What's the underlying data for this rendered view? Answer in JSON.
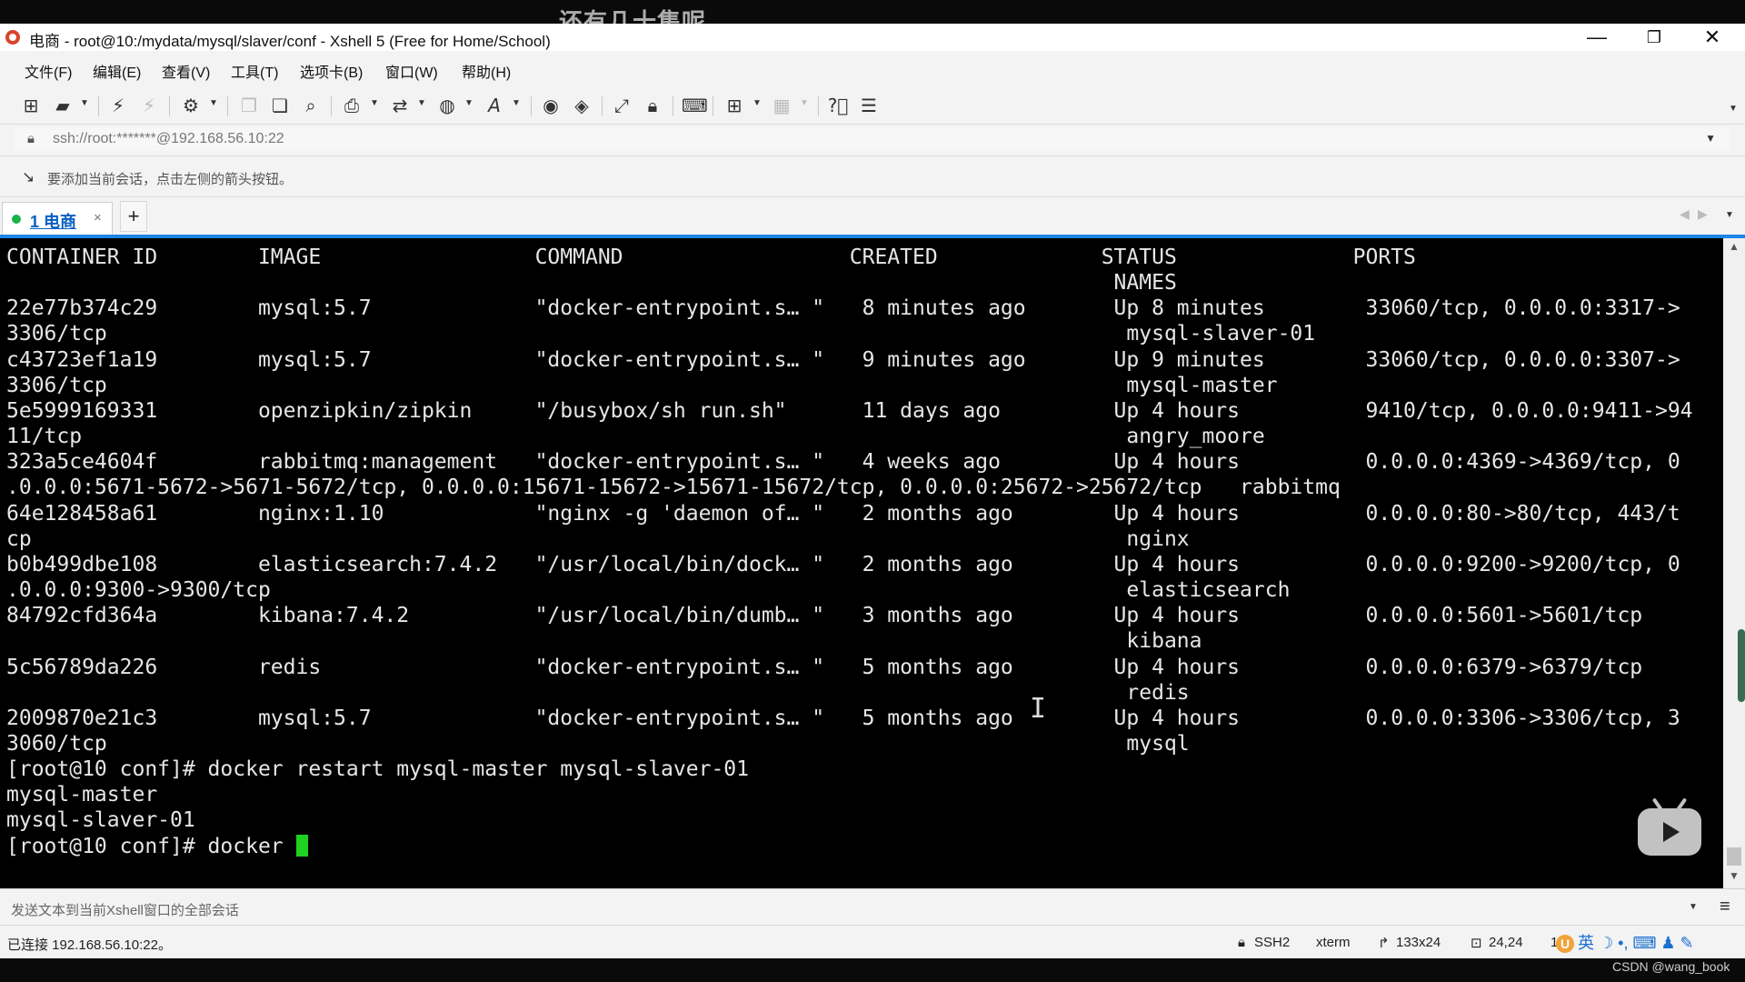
{
  "overlay_caption": "还有几十集呢",
  "window": {
    "title": "电商 - root@10:/mydata/mysql/slaver/conf - Xshell 5 (Free for Home/School)",
    "minimize": "—",
    "restore": "❐",
    "close": "✕"
  },
  "menu": [
    {
      "label": "文件(F)"
    },
    {
      "label": "编辑(E)"
    },
    {
      "label": "查看(V)"
    },
    {
      "label": "工具(T)"
    },
    {
      "label": "选项卡(B)"
    },
    {
      "label": "窗口(W)"
    },
    {
      "label": "帮助(H)"
    }
  ],
  "address": {
    "value": "ssh://root:*******@192.168.56.10:22"
  },
  "hint": {
    "text": "要添加当前会话，点击左侧的箭头按钮。"
  },
  "tabs": {
    "active_label": "1 电商",
    "add_label": "+"
  },
  "terminal": {
    "lines": [
      "CONTAINER ID        IMAGE                 COMMAND                  CREATED             STATUS              PORTS",
      "                                                                                        NAMES",
      "22e77b374c29        mysql:5.7             \"docker-entrypoint.s… \"   8 minutes ago       Up 8 minutes        33060/tcp, 0.0.0.0:3317->",
      "3306/tcp                                                                                 mysql-slaver-01",
      "c43723ef1a19        mysql:5.7             \"docker-entrypoint.s… \"   9 minutes ago       Up 9 minutes        33060/tcp, 0.0.0.0:3307->",
      "3306/tcp                                                                                 mysql-master",
      "5e5999169331        openzipkin/zipkin     \"/busybox/sh run.sh\"      11 days ago         Up 4 hours          9410/tcp, 0.0.0.0:9411->94",
      "11/tcp                                                                                   angry_moore",
      "323a5ce4604f        rabbitmq:management   \"docker-entrypoint.s… \"   4 weeks ago         Up 4 hours          0.0.0.0:4369->4369/tcp, 0",
      ".0.0.0:5671-5672->5671-5672/tcp, 0.0.0.0:15671-15672->15671-15672/tcp, 0.0.0.0:25672->25672/tcp   rabbitmq",
      "64e128458a61        nginx:1.10            \"nginx -g 'daemon of… \"   2 months ago        Up 4 hours          0.0.0.0:80->80/tcp, 443/t",
      "cp                                                                                       nginx",
      "b0b499dbe108        elasticsearch:7.4.2   \"/usr/local/bin/dock… \"   2 months ago        Up 4 hours          0.0.0.0:9200->9200/tcp, 0",
      ".0.0.0:9300->9300/tcp                                                                    elasticsearch",
      "84792cfd364a        kibana:7.4.2          \"/usr/local/bin/dumb… \"   3 months ago        Up 4 hours          0.0.0.0:5601->5601/tcp",
      "                                                                                         kibana",
      "5c56789da226        redis                 \"docker-entrypoint.s… \"   5 months ago        Up 4 hours          0.0.0.0:6379->6379/tcp",
      "                                                                                         redis",
      "2009870e21c3        mysql:5.7             \"docker-entrypoint.s… \"   5 months ago        Up 4 hours          0.0.0.0:3306->3306/tcp, 3",
      "3060/tcp                                                                                 mysql",
      "[root@10 conf]# docker restart mysql-master mysql-slaver-01",
      "mysql-master",
      "mysql-slaver-01"
    ],
    "prompt": "[root@10 conf]# docker "
  },
  "compose": {
    "placeholder": "发送文本到当前Xshell窗口的全部会话"
  },
  "status": {
    "connection": "已连接 192.168.56.10:22。",
    "protocol": "SSH2",
    "term": "xterm",
    "size": "133x24",
    "cursor_pos": "24,24",
    "sessions": "1",
    "ime": "英 ☽ •, ⌨ ♟ ✎"
  },
  "watermark": "CSDN @wang_book"
}
